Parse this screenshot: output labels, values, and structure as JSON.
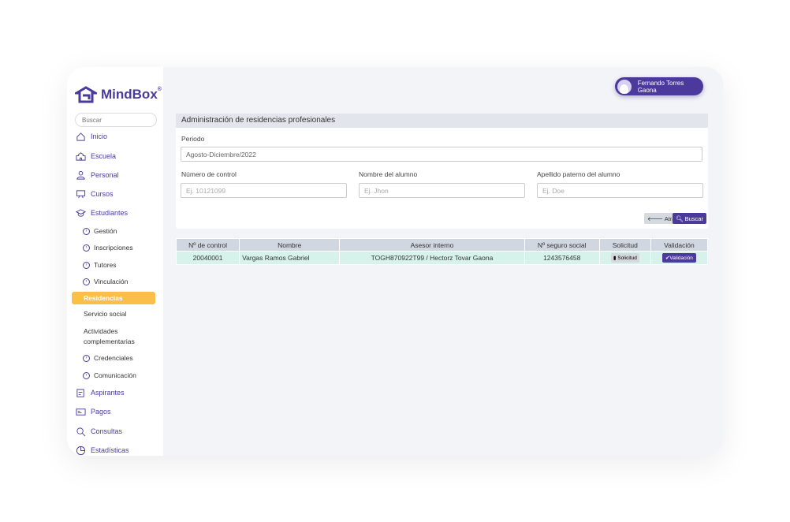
{
  "brand": {
    "name": "MindBox",
    "mark": "®"
  },
  "sidebar": {
    "search_placeholder": "Buscar",
    "main_items": [
      {
        "label": "Inicio",
        "icon": "home-icon"
      },
      {
        "label": "Escuela",
        "icon": "school-icon"
      },
      {
        "label": "Personal",
        "icon": "person-icon"
      },
      {
        "label": "Cursos",
        "icon": "board-icon"
      },
      {
        "label": "Estudiantes",
        "icon": "graduation-cap-icon"
      }
    ],
    "sub_items": [
      "Gestión",
      "Inscripciones",
      "Tutores",
      "Vinculación"
    ],
    "active": "Residencias",
    "plain_items": [
      "Servicio social",
      "Actividades complementarias"
    ],
    "sub_items2": [
      "Credenciales",
      "Comunicación"
    ],
    "bottom_items": [
      {
        "label": "Aspirantes",
        "icon": "clipboard-icon"
      },
      {
        "label": "Pagos",
        "icon": "card-icon"
      },
      {
        "label": "Consultas",
        "icon": "search-icon"
      },
      {
        "label": "Estadísticas",
        "icon": "pie-chart-icon"
      }
    ]
  },
  "user": {
    "name": "Fernando Torres Gaona"
  },
  "panel": {
    "title": "Administración de residencias profesionales",
    "periodo_label": "Periodo",
    "periodo_value": "Agosto-Diciembre/2022",
    "control_label": "Número de control",
    "control_placeholder": "Ej. 10121099",
    "nombre_label": "Nombre del alumno",
    "nombre_placeholder": "Ej. Jhon",
    "apellido_label": "Apellido paterno del alumno",
    "apellido_placeholder": "Ej. Doe",
    "back_label": "🡐 Atrás",
    "search_label": "🔍︎ Buscar"
  },
  "table": {
    "headers": [
      "Nº de control",
      "Nombre",
      "Asesor interno",
      "Nº seguro social",
      "Solicitud",
      "Validación"
    ],
    "rows": [
      {
        "control": "20040001",
        "nombre": "Vargas Ramos Gabriel",
        "asesor": "TOGH870922T99 / Hectorz Tovar Gaona",
        "nss": "1243576458",
        "solicitud": "Solicitud",
        "validacion": "Validación"
      }
    ]
  },
  "colors": {
    "primary": "#4b3a9c",
    "active": "#f9bf4a",
    "row": "#d6f2ea"
  }
}
